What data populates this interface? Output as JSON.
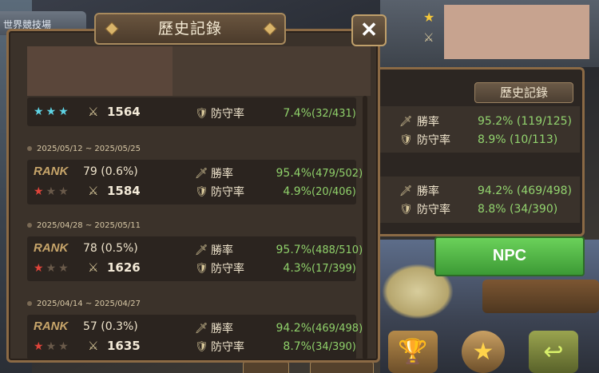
{
  "background": {
    "left_tab_text": "世界競技場"
  },
  "dialog": {
    "title": "歷史記錄",
    "close_label": "✕"
  },
  "labels": {
    "win_rate": "勝率",
    "defense_rate": "防守率",
    "rank_tag": "RANK"
  },
  "entries": [
    {
      "date": "",
      "stars": "cyan3",
      "score": "1564",
      "defense_pct": "7.4%",
      "defense_frac": "(32/431)"
    },
    {
      "date": "2025/05/12 ~ 2025/05/25",
      "rank": "79 (0.6%)",
      "stars": "red1",
      "score": "1584",
      "win_pct": "95.4%",
      "win_frac": "(479/502)",
      "defense_pct": "4.9%",
      "defense_frac": "(20/406)"
    },
    {
      "date": "2025/04/28 ~ 2025/05/11",
      "rank": "78 (0.5%)",
      "stars": "red1",
      "score": "1626",
      "win_pct": "95.7%",
      "win_frac": "(488/510)",
      "defense_pct": "4.3%",
      "defense_frac": "(17/399)"
    },
    {
      "date": "2025/04/14 ~ 2025/04/27",
      "rank": "57 (0.3%)",
      "stars": "red1",
      "score": "1635",
      "win_pct": "94.2%",
      "win_frac": "(469/498)",
      "defense_pct": "8.7%",
      "defense_frac": "(34/390)"
    }
  ],
  "right_panel": {
    "history_button": "歷史記錄",
    "block1": {
      "win": "95.2% (119/125)",
      "defense": "8.9% (10/113)"
    },
    "block2": {
      "win": "94.2% (469/498)",
      "defense": "8.8% (34/390)"
    },
    "npc_button": "NPC"
  },
  "colors": {
    "accent_green": "#8fd06a",
    "star_red": "#e0443a",
    "star_cyan": "#5fd5e6",
    "panel_border": "#8b6a45",
    "npc_green": "#4caf3e"
  },
  "icons": [
    "sword-icon",
    "shield-icon",
    "star-icon",
    "close-icon",
    "trophy-icon",
    "back-arrow-icon"
  ]
}
